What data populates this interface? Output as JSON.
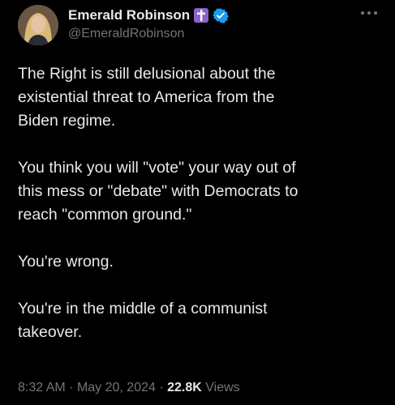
{
  "author": {
    "display_name": "Emerald Robinson",
    "handle": "@EmeraldRobinson",
    "badges": [
      "cross-icon",
      "verified-icon"
    ]
  },
  "tweet": {
    "lines_p1": [
      "The Right is still delusional about the",
      "existential threat to America from the",
      "Biden regime."
    ],
    "lines_p2": [
      "You think you will \"vote\" your way out of",
      "this mess or \"debate\" with Democrats to",
      "reach \"common ground.\""
    ],
    "lines_p3": [
      "You're wrong."
    ],
    "lines_p4": [
      "You're in the middle of a communist",
      "takeover."
    ]
  },
  "meta": {
    "time": "8:32 AM",
    "separator": "·",
    "date": "May 20, 2024",
    "views_count": "22.8K",
    "views_label": "Views"
  },
  "colors": {
    "background": "#000000",
    "text": "#e7e9ea",
    "muted": "#71767b",
    "verified": "#1d9bf0",
    "cross_badge": "#8a63c8"
  }
}
